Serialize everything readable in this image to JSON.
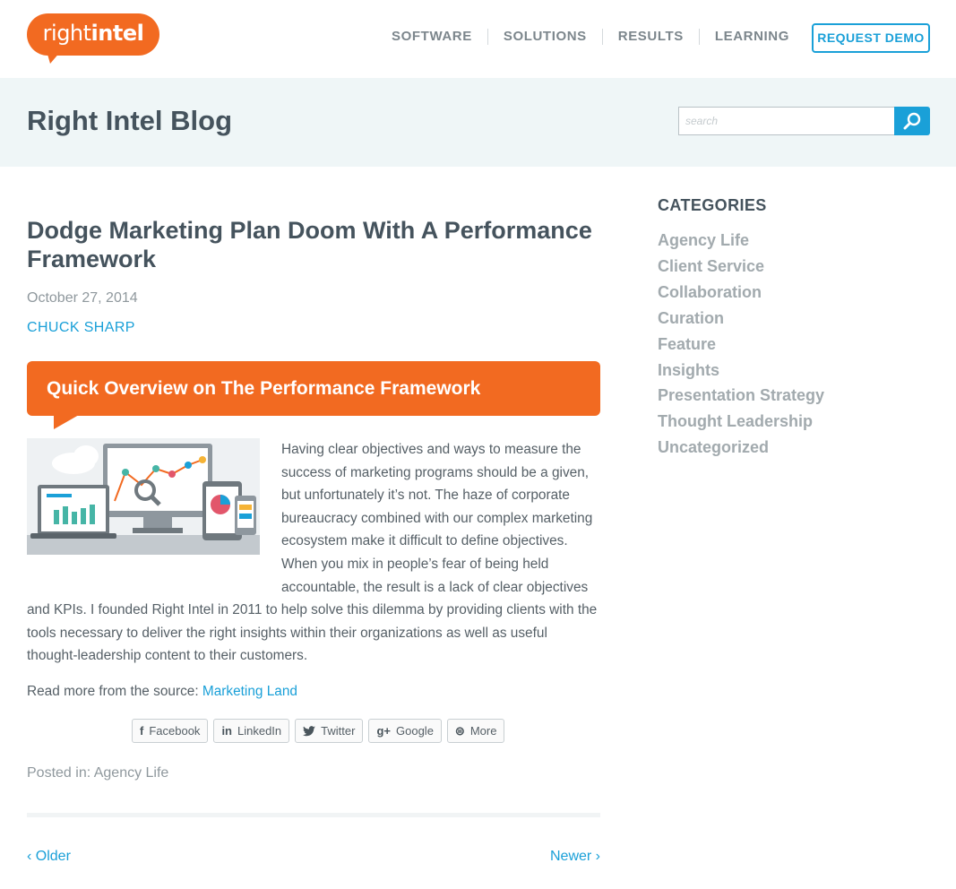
{
  "header": {
    "logo_text_light": "right",
    "logo_text_bold": "intel",
    "nav": [
      "SOFTWARE",
      "SOLUTIONS",
      "RESULTS",
      "LEARNING"
    ],
    "demo_label": "REQUEST DEMO"
  },
  "band": {
    "title": "Right Intel Blog",
    "search_placeholder": "search",
    "search_icon": "magnifier-icon"
  },
  "post": {
    "title": "Dodge Marketing Plan Doom With A Performance Framework",
    "date": "October 27, 2014",
    "author": "CHUCK SHARP",
    "banner": "Quick Overview on The Performance Framework",
    "body": "Having clear objectives and ways to measure the success of marketing programs should be a given, but unfortunately it’s not. The haze of corporate bureaucracy combined with our complex marketing ecosystem make it difficult to define objectives. When you mix in people’s fear of being held accountable, the result is a lack of clear objectives and KPIs. I founded Right Intel in 2011 to help solve this dilemma by providing clients with the tools necessary to deliver the right insights within their organizations as well as useful thought-leadership content to their customers.",
    "source_prefix": "Read more from the source:",
    "source_link": "Marketing Land",
    "share": [
      {
        "icon": "f",
        "label": "Facebook"
      },
      {
        "icon": "in",
        "label": "LinkedIn"
      },
      {
        "icon": "🐦",
        "label": "Twitter"
      },
      {
        "icon": "g+",
        "label": "Google"
      },
      {
        "icon": "⊜",
        "label": "More"
      }
    ],
    "posted_in": "Posted in: Agency Life",
    "older": "‹ Older",
    "newer": "Newer ›"
  },
  "sidebar": {
    "heading": "CATEGORIES",
    "categories": [
      "Agency Life",
      "Client Service",
      "Collaboration",
      "Curation",
      "Feature",
      "Insights",
      "Presentation Strategy",
      "Thought Leadership",
      "Uncategorized"
    ]
  },
  "colors": {
    "brand_orange": "#f26a21",
    "link_blue": "#1aa0d8",
    "band_bg": "#eff6f7"
  }
}
